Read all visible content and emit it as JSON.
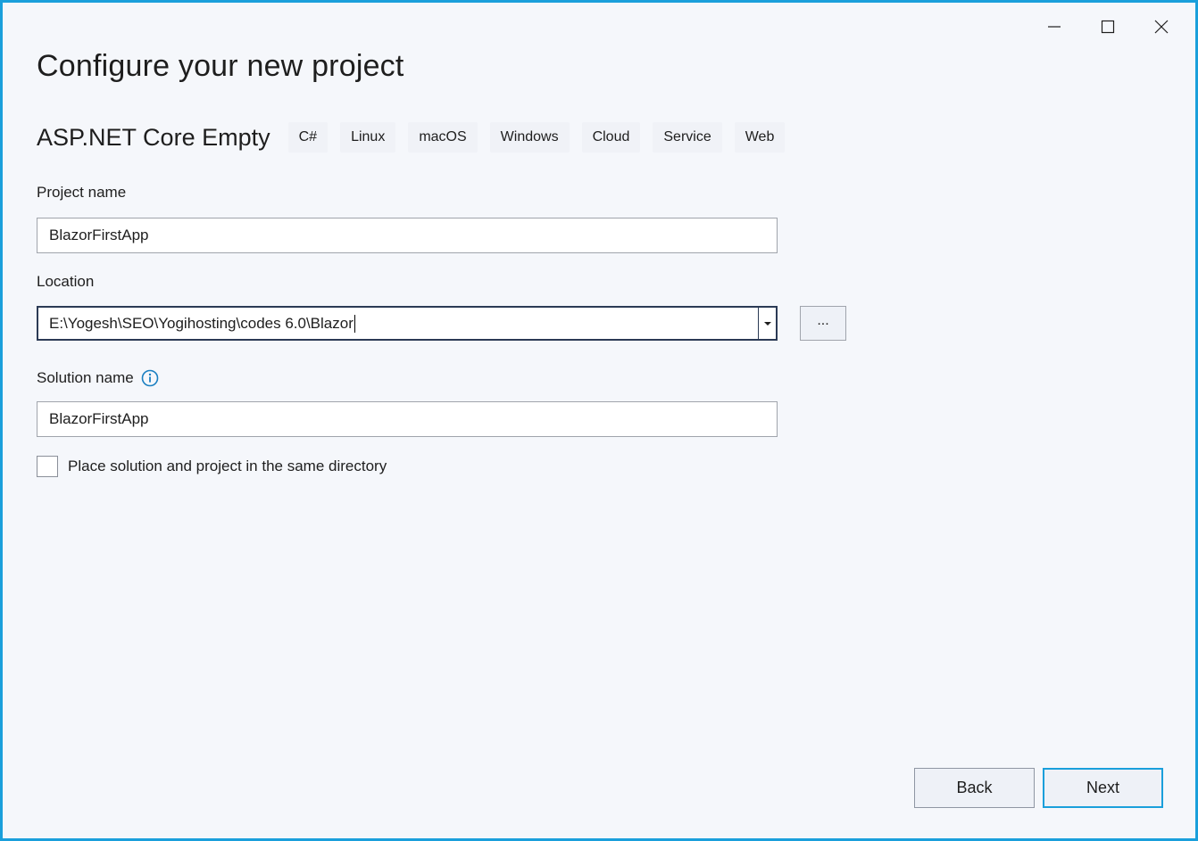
{
  "page": {
    "title": "Configure your new project"
  },
  "window_controls": {
    "minimize_icon": "minimize-icon",
    "maximize_icon": "maximize-icon",
    "close_icon": "close-icon"
  },
  "template": {
    "name": "ASP.NET Core Empty",
    "tags": [
      "C#",
      "Linux",
      "macOS",
      "Windows",
      "Cloud",
      "Service",
      "Web"
    ]
  },
  "form": {
    "project_name": {
      "label": "Project name",
      "value": "BlazorFirstApp"
    },
    "location": {
      "label": "Location",
      "value": "E:\\Yogesh\\SEO\\Yogihosting\\codes 6.0\\Blazor",
      "browse_label": "..."
    },
    "solution_name": {
      "label": "Solution name",
      "value": "BlazorFirstApp",
      "info_icon": "info-icon"
    },
    "same_directory": {
      "label": "Place solution and project in the same directory",
      "checked": false
    }
  },
  "footer": {
    "back_label": "Back",
    "next_label": "Next"
  },
  "colors": {
    "accent": "#1a9fdb",
    "background": "#f5f7fb",
    "tag_background": "#f0f2f7",
    "info_icon": "#1a7fc1"
  }
}
